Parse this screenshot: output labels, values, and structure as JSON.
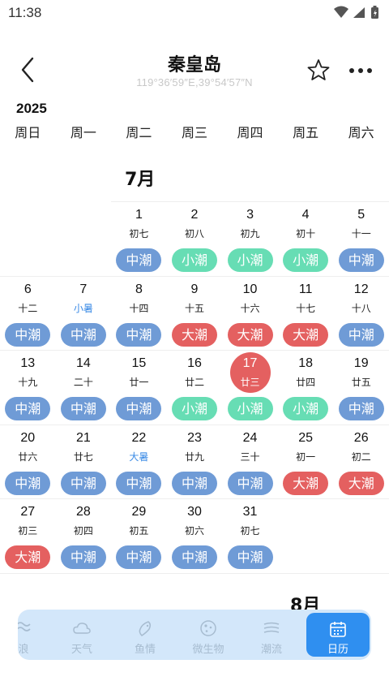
{
  "status_bar": {
    "time": "11:38"
  },
  "header": {
    "title": "秦皇岛",
    "coords": "119°36′59″E,39°54′57″N"
  },
  "year": "2025",
  "weekdays": [
    "周日",
    "周一",
    "周二",
    "周三",
    "周四",
    "周五",
    "周六"
  ],
  "months": {
    "july": "7月",
    "august": "8月"
  },
  "july_rows": [
    [
      null,
      null,
      {
        "day": "1",
        "lunar": "初七",
        "tide": "中潮",
        "level": "mid"
      },
      {
        "day": "2",
        "lunar": "初八",
        "tide": "小潮",
        "level": "small"
      },
      {
        "day": "3",
        "lunar": "初九",
        "tide": "小潮",
        "level": "small"
      },
      {
        "day": "4",
        "lunar": "初十",
        "tide": "小潮",
        "level": "small"
      },
      {
        "day": "5",
        "lunar": "十一",
        "tide": "中潮",
        "level": "mid"
      }
    ],
    [
      {
        "day": "6",
        "lunar": "十二",
        "tide": "中潮",
        "level": "mid"
      },
      {
        "day": "7",
        "lunar": "小暑",
        "tide": "中潮",
        "level": "mid",
        "term": true
      },
      {
        "day": "8",
        "lunar": "十四",
        "tide": "中潮",
        "level": "mid"
      },
      {
        "day": "9",
        "lunar": "十五",
        "tide": "大潮",
        "level": "big"
      },
      {
        "day": "10",
        "lunar": "十六",
        "tide": "大潮",
        "level": "big"
      },
      {
        "day": "11",
        "lunar": "十七",
        "tide": "大潮",
        "level": "big"
      },
      {
        "day": "12",
        "lunar": "十八",
        "tide": "中潮",
        "level": "mid"
      }
    ],
    [
      {
        "day": "13",
        "lunar": "十九",
        "tide": "中潮",
        "level": "mid"
      },
      {
        "day": "14",
        "lunar": "二十",
        "tide": "中潮",
        "level": "mid"
      },
      {
        "day": "15",
        "lunar": "廿一",
        "tide": "中潮",
        "level": "mid"
      },
      {
        "day": "16",
        "lunar": "廿二",
        "tide": "小潮",
        "level": "small"
      },
      {
        "day": "17",
        "lunar": "廿三",
        "tide": "小潮",
        "level": "small",
        "today": true
      },
      {
        "day": "18",
        "lunar": "廿四",
        "tide": "小潮",
        "level": "small"
      },
      {
        "day": "19",
        "lunar": "廿五",
        "tide": "中潮",
        "level": "mid"
      }
    ],
    [
      {
        "day": "20",
        "lunar": "廿六",
        "tide": "中潮",
        "level": "mid"
      },
      {
        "day": "21",
        "lunar": "廿七",
        "tide": "中潮",
        "level": "mid"
      },
      {
        "day": "22",
        "lunar": "大暑",
        "tide": "中潮",
        "level": "mid",
        "term": true
      },
      {
        "day": "23",
        "lunar": "廿九",
        "tide": "中潮",
        "level": "mid"
      },
      {
        "day": "24",
        "lunar": "三十",
        "tide": "中潮",
        "level": "mid"
      },
      {
        "day": "25",
        "lunar": "初一",
        "tide": "大潮",
        "level": "big"
      },
      {
        "day": "26",
        "lunar": "初二",
        "tide": "大潮",
        "level": "big"
      }
    ],
    [
      {
        "day": "27",
        "lunar": "初三",
        "tide": "大潮",
        "level": "big"
      },
      {
        "day": "28",
        "lunar": "初四",
        "tide": "中潮",
        "level": "mid"
      },
      {
        "day": "29",
        "lunar": "初五",
        "tide": "中潮",
        "level": "mid"
      },
      {
        "day": "30",
        "lunar": "初六",
        "tide": "中潮",
        "level": "mid"
      },
      {
        "day": "31",
        "lunar": "初七",
        "tide": "中潮",
        "level": "mid"
      },
      null,
      null
    ]
  ],
  "bottom_nav": [
    {
      "label": "浪",
      "icon": "wave-icon"
    },
    {
      "label": "天气",
      "icon": "cloud-icon"
    },
    {
      "label": "鱼情",
      "icon": "fish-icon"
    },
    {
      "label": "微生物",
      "icon": "microbe-icon"
    },
    {
      "label": "潮流",
      "icon": "current-icon"
    },
    {
      "label": "日历",
      "icon": "calendar-icon",
      "active": true
    }
  ],
  "colors": {
    "mid_tide": "#6f9bd6",
    "small_tide": "#67ddb4",
    "big_tide": "#e46060",
    "nav_active": "#2f8ff0",
    "solar_term": "#3b8be6"
  }
}
